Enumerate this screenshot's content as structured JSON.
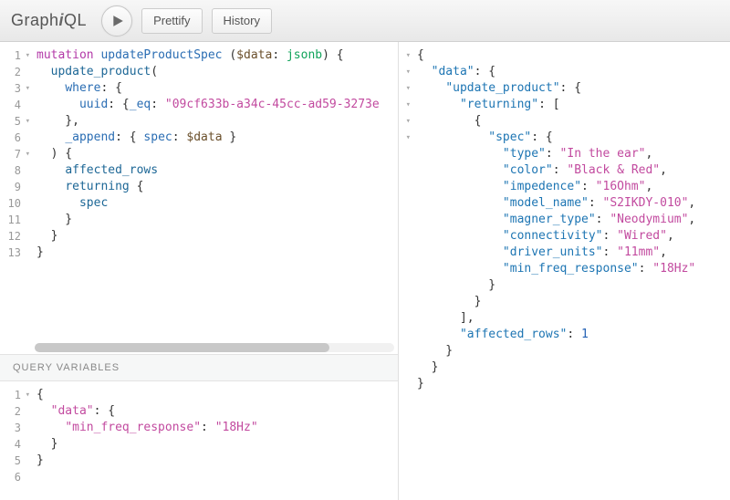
{
  "header": {
    "logo_prefix": "Graph",
    "logo_i": "i",
    "logo_suffix": "QL",
    "prettify": "Prettify",
    "history": "History"
  },
  "query_editor": {
    "lines": [
      {
        "n": "1",
        "fold": "▾",
        "html": "<span class='kw'>mutation</span> <span class='def'>updateProductSpec</span> (<span class='var'>$data</span>: <span class='typ'>jsonb</span>) {"
      },
      {
        "n": "2",
        "fold": "",
        "html": "  <span class='prop'>update_product</span>("
      },
      {
        "n": "3",
        "fold": "▾",
        "html": "    <span class='attr'>where</span>: {"
      },
      {
        "n": "4",
        "fold": "",
        "html": "      <span class='attr'>uuid</span>: {<span class='attr'>_eq</span>: <span class='str'>\"09cf633b-a34c-45cc-ad59-3273e</span>"
      },
      {
        "n": "5",
        "fold": "▾",
        "html": "    },"
      },
      {
        "n": "6",
        "fold": "",
        "html": "    <span class='attr'>_append</span>: { <span class='attr'>spec</span>: <span class='var'>$data</span> }"
      },
      {
        "n": "7",
        "fold": "▾",
        "html": "  ) {"
      },
      {
        "n": "8",
        "fold": "",
        "html": "    <span class='prop'>affected_rows</span>"
      },
      {
        "n": "9",
        "fold": "",
        "html": "    <span class='prop'>returning</span> {"
      },
      {
        "n": "10",
        "fold": "",
        "html": "      <span class='prop'>spec</span>"
      },
      {
        "n": "11",
        "fold": "",
        "html": "    }"
      },
      {
        "n": "12",
        "fold": "",
        "html": "  }"
      },
      {
        "n": "13",
        "fold": "",
        "html": "}"
      }
    ]
  },
  "query_variables_label": "Query Variables",
  "variables_editor": {
    "lines": [
      {
        "n": "1",
        "fold": "▾",
        "html": "{"
      },
      {
        "n": "2",
        "fold": "",
        "html": "  <span class='str'>\"data\"</span>: {"
      },
      {
        "n": "3",
        "fold": "",
        "html": "    <span class='str'>\"min_freq_response\"</span>: <span class='str'>\"18Hz\"</span>"
      },
      {
        "n": "4",
        "fold": "",
        "html": "  }"
      },
      {
        "n": "5",
        "fold": "",
        "html": "}"
      },
      {
        "n": "6",
        "fold": "",
        "html": ""
      }
    ]
  },
  "result_editor": {
    "lines": [
      {
        "fold": "▾",
        "html": "{"
      },
      {
        "fold": "▾",
        "html": "  <span class='rkey'>\"data\"</span>: {"
      },
      {
        "fold": "▾",
        "html": "    <span class='rkey'>\"update_product\"</span>: {"
      },
      {
        "fold": "▾",
        "html": "      <span class='rkey'>\"returning\"</span>: ["
      },
      {
        "fold": "▾",
        "html": "        {"
      },
      {
        "fold": "▾",
        "html": "          <span class='rkey'>\"spec\"</span>: {"
      },
      {
        "fold": "",
        "html": "            <span class='rkey'>\"type\"</span>: <span class='rstr'>\"In the ear\"</span>,"
      },
      {
        "fold": "",
        "html": "            <span class='rkey'>\"color\"</span>: <span class='rstr'>\"Black &amp; Red\"</span>,"
      },
      {
        "fold": "",
        "html": "            <span class='rkey'>\"impedence\"</span>: <span class='rstr'>\"16Ohm\"</span>,"
      },
      {
        "fold": "",
        "html": "            <span class='rkey'>\"model_name\"</span>: <span class='rstr'>\"S2IKDY-010\"</span>,"
      },
      {
        "fold": "",
        "html": "            <span class='rkey'>\"magner_type\"</span>: <span class='rstr'>\"Neodymium\"</span>,"
      },
      {
        "fold": "",
        "html": "            <span class='rkey'>\"connectivity\"</span>: <span class='rstr'>\"Wired\"</span>,"
      },
      {
        "fold": "",
        "html": "            <span class='rkey'>\"driver_units\"</span>: <span class='rstr'>\"11mm\"</span>,"
      },
      {
        "fold": "",
        "html": "            <span class='rkey'>\"min_freq_response\"</span>: <span class='rstr'>\"18Hz\"</span>"
      },
      {
        "fold": "",
        "html": "          }"
      },
      {
        "fold": "",
        "html": "        }"
      },
      {
        "fold": "",
        "html": "      ],"
      },
      {
        "fold": "",
        "html": "      <span class='rkey'>\"affected_rows\"</span>: <span class='rnum'>1</span>"
      },
      {
        "fold": "",
        "html": "    }"
      },
      {
        "fold": "",
        "html": "  }"
      },
      {
        "fold": "",
        "html": "}"
      }
    ]
  }
}
